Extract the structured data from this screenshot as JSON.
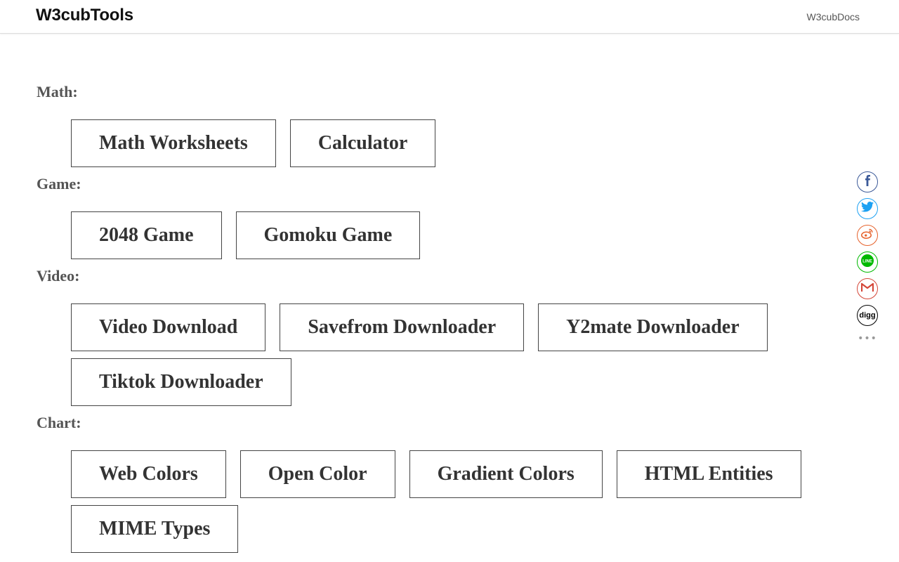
{
  "header": {
    "brand": "W3cubTools",
    "docs_link": "W3cubDocs"
  },
  "sections": [
    {
      "title": "Math:",
      "buttons": [
        "Math Worksheets",
        "Calculator"
      ]
    },
    {
      "title": "Game:",
      "buttons": [
        "2048 Game",
        "Gomoku Game"
      ]
    },
    {
      "title": "Video:",
      "buttons": [
        "Video Download",
        "Savefrom Downloader",
        "Y2mate Downloader",
        "Tiktok Downloader"
      ]
    },
    {
      "title": "Chart:",
      "buttons": [
        "Web Colors",
        "Open Color",
        "Gradient Colors",
        "HTML Entities",
        "MIME Types"
      ]
    }
  ],
  "share": {
    "items": [
      {
        "name": "facebook-share",
        "icon": "facebook-icon",
        "color": "#3b5998"
      },
      {
        "name": "twitter-share",
        "icon": "twitter-icon",
        "color": "#1da1f2"
      },
      {
        "name": "weibo-share",
        "icon": "weibo-icon",
        "color": "#e6622c"
      },
      {
        "name": "line-share",
        "icon": "line-icon",
        "color": "#00b900"
      },
      {
        "name": "gmail-share",
        "icon": "gmail-icon",
        "color": "#d44638"
      },
      {
        "name": "digg-share",
        "icon": "digg-icon",
        "color": "#000000",
        "label": "digg"
      }
    ],
    "more": "•••"
  }
}
